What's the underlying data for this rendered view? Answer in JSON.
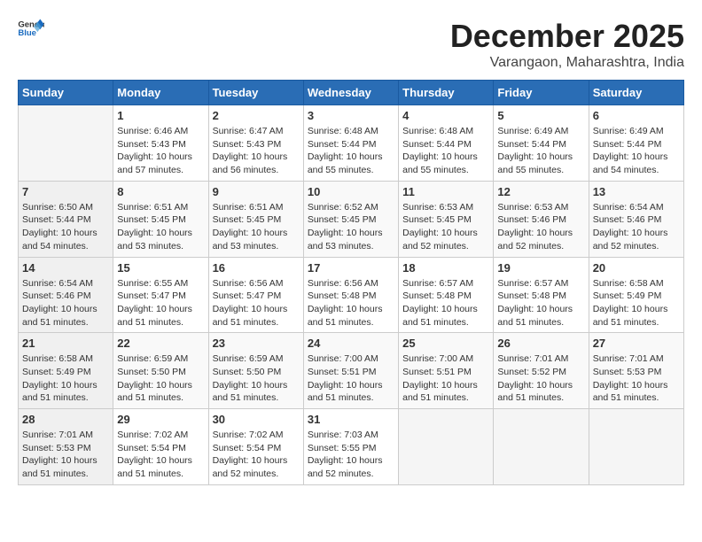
{
  "header": {
    "logo_general": "General",
    "logo_blue": "Blue",
    "title": "December 2025",
    "subtitle": "Varangaon, Maharashtra, India"
  },
  "weekdays": [
    "Sunday",
    "Monday",
    "Tuesday",
    "Wednesday",
    "Thursday",
    "Friday",
    "Saturday"
  ],
  "weeks": [
    [
      {
        "day": "",
        "info": ""
      },
      {
        "day": "1",
        "info": "Sunrise: 6:46 AM\nSunset: 5:43 PM\nDaylight: 10 hours\nand 57 minutes."
      },
      {
        "day": "2",
        "info": "Sunrise: 6:47 AM\nSunset: 5:43 PM\nDaylight: 10 hours\nand 56 minutes."
      },
      {
        "day": "3",
        "info": "Sunrise: 6:48 AM\nSunset: 5:44 PM\nDaylight: 10 hours\nand 55 minutes."
      },
      {
        "day": "4",
        "info": "Sunrise: 6:48 AM\nSunset: 5:44 PM\nDaylight: 10 hours\nand 55 minutes."
      },
      {
        "day": "5",
        "info": "Sunrise: 6:49 AM\nSunset: 5:44 PM\nDaylight: 10 hours\nand 55 minutes."
      },
      {
        "day": "6",
        "info": "Sunrise: 6:49 AM\nSunset: 5:44 PM\nDaylight: 10 hours\nand 54 minutes."
      }
    ],
    [
      {
        "day": "7",
        "info": "Sunrise: 6:50 AM\nSunset: 5:44 PM\nDaylight: 10 hours\nand 54 minutes."
      },
      {
        "day": "8",
        "info": "Sunrise: 6:51 AM\nSunset: 5:45 PM\nDaylight: 10 hours\nand 53 minutes."
      },
      {
        "day": "9",
        "info": "Sunrise: 6:51 AM\nSunset: 5:45 PM\nDaylight: 10 hours\nand 53 minutes."
      },
      {
        "day": "10",
        "info": "Sunrise: 6:52 AM\nSunset: 5:45 PM\nDaylight: 10 hours\nand 53 minutes."
      },
      {
        "day": "11",
        "info": "Sunrise: 6:53 AM\nSunset: 5:45 PM\nDaylight: 10 hours\nand 52 minutes."
      },
      {
        "day": "12",
        "info": "Sunrise: 6:53 AM\nSunset: 5:46 PM\nDaylight: 10 hours\nand 52 minutes."
      },
      {
        "day": "13",
        "info": "Sunrise: 6:54 AM\nSunset: 5:46 PM\nDaylight: 10 hours\nand 52 minutes."
      }
    ],
    [
      {
        "day": "14",
        "info": "Sunrise: 6:54 AM\nSunset: 5:46 PM\nDaylight: 10 hours\nand 51 minutes."
      },
      {
        "day": "15",
        "info": "Sunrise: 6:55 AM\nSunset: 5:47 PM\nDaylight: 10 hours\nand 51 minutes."
      },
      {
        "day": "16",
        "info": "Sunrise: 6:56 AM\nSunset: 5:47 PM\nDaylight: 10 hours\nand 51 minutes."
      },
      {
        "day": "17",
        "info": "Sunrise: 6:56 AM\nSunset: 5:48 PM\nDaylight: 10 hours\nand 51 minutes."
      },
      {
        "day": "18",
        "info": "Sunrise: 6:57 AM\nSunset: 5:48 PM\nDaylight: 10 hours\nand 51 minutes."
      },
      {
        "day": "19",
        "info": "Sunrise: 6:57 AM\nSunset: 5:48 PM\nDaylight: 10 hours\nand 51 minutes."
      },
      {
        "day": "20",
        "info": "Sunrise: 6:58 AM\nSunset: 5:49 PM\nDaylight: 10 hours\nand 51 minutes."
      }
    ],
    [
      {
        "day": "21",
        "info": "Sunrise: 6:58 AM\nSunset: 5:49 PM\nDaylight: 10 hours\nand 51 minutes."
      },
      {
        "day": "22",
        "info": "Sunrise: 6:59 AM\nSunset: 5:50 PM\nDaylight: 10 hours\nand 51 minutes."
      },
      {
        "day": "23",
        "info": "Sunrise: 6:59 AM\nSunset: 5:50 PM\nDaylight: 10 hours\nand 51 minutes."
      },
      {
        "day": "24",
        "info": "Sunrise: 7:00 AM\nSunset: 5:51 PM\nDaylight: 10 hours\nand 51 minutes."
      },
      {
        "day": "25",
        "info": "Sunrise: 7:00 AM\nSunset: 5:51 PM\nDaylight: 10 hours\nand 51 minutes."
      },
      {
        "day": "26",
        "info": "Sunrise: 7:01 AM\nSunset: 5:52 PM\nDaylight: 10 hours\nand 51 minutes."
      },
      {
        "day": "27",
        "info": "Sunrise: 7:01 AM\nSunset: 5:53 PM\nDaylight: 10 hours\nand 51 minutes."
      }
    ],
    [
      {
        "day": "28",
        "info": "Sunrise: 7:01 AM\nSunset: 5:53 PM\nDaylight: 10 hours\nand 51 minutes."
      },
      {
        "day": "29",
        "info": "Sunrise: 7:02 AM\nSunset: 5:54 PM\nDaylight: 10 hours\nand 51 minutes."
      },
      {
        "day": "30",
        "info": "Sunrise: 7:02 AM\nSunset: 5:54 PM\nDaylight: 10 hours\nand 52 minutes."
      },
      {
        "day": "31",
        "info": "Sunrise: 7:03 AM\nSunset: 5:55 PM\nDaylight: 10 hours\nand 52 minutes."
      },
      {
        "day": "",
        "info": ""
      },
      {
        "day": "",
        "info": ""
      },
      {
        "day": "",
        "info": ""
      }
    ]
  ]
}
